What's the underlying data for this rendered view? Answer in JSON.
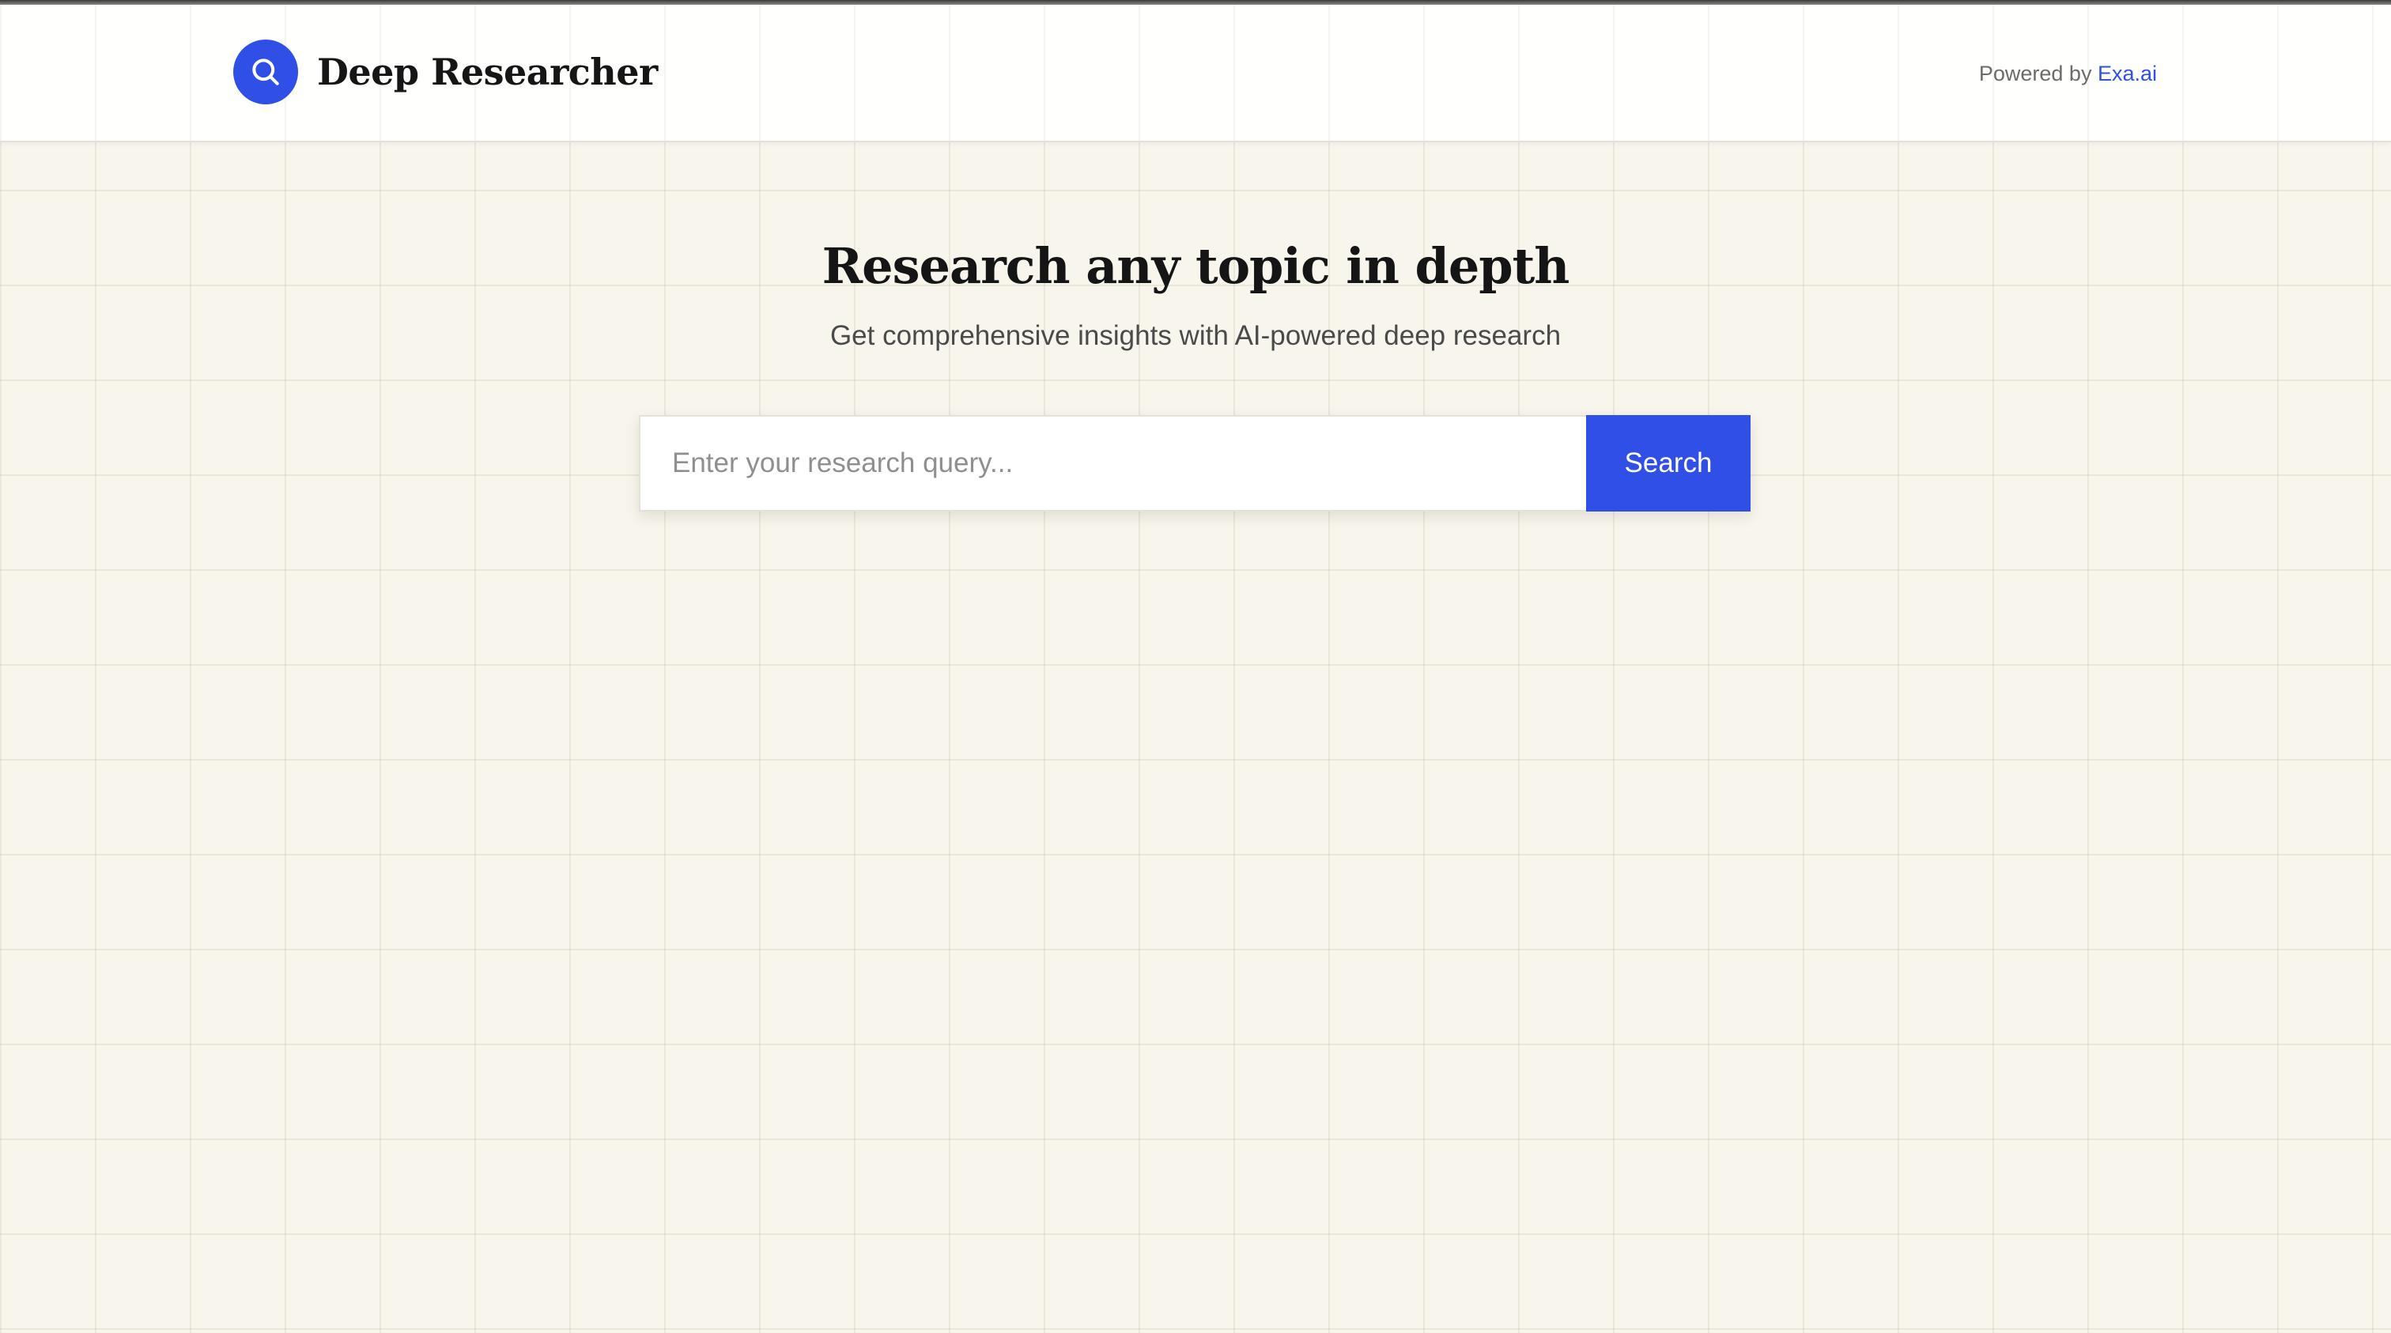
{
  "header": {
    "app_title": "Deep Researcher",
    "logo_icon": "search-icon",
    "powered_by_prefix": "Powered by ",
    "powered_by_link": "Exa.ai"
  },
  "hero": {
    "title": "Research any topic in depth",
    "subtitle": "Get comprehensive insights with AI-powered deep research"
  },
  "search": {
    "placeholder": "Enter your research query...",
    "value": "",
    "button_label": "Search"
  },
  "colors": {
    "accent": "#2f4fe6",
    "background": "#f8f6ec",
    "header_background": "#ffffff"
  }
}
